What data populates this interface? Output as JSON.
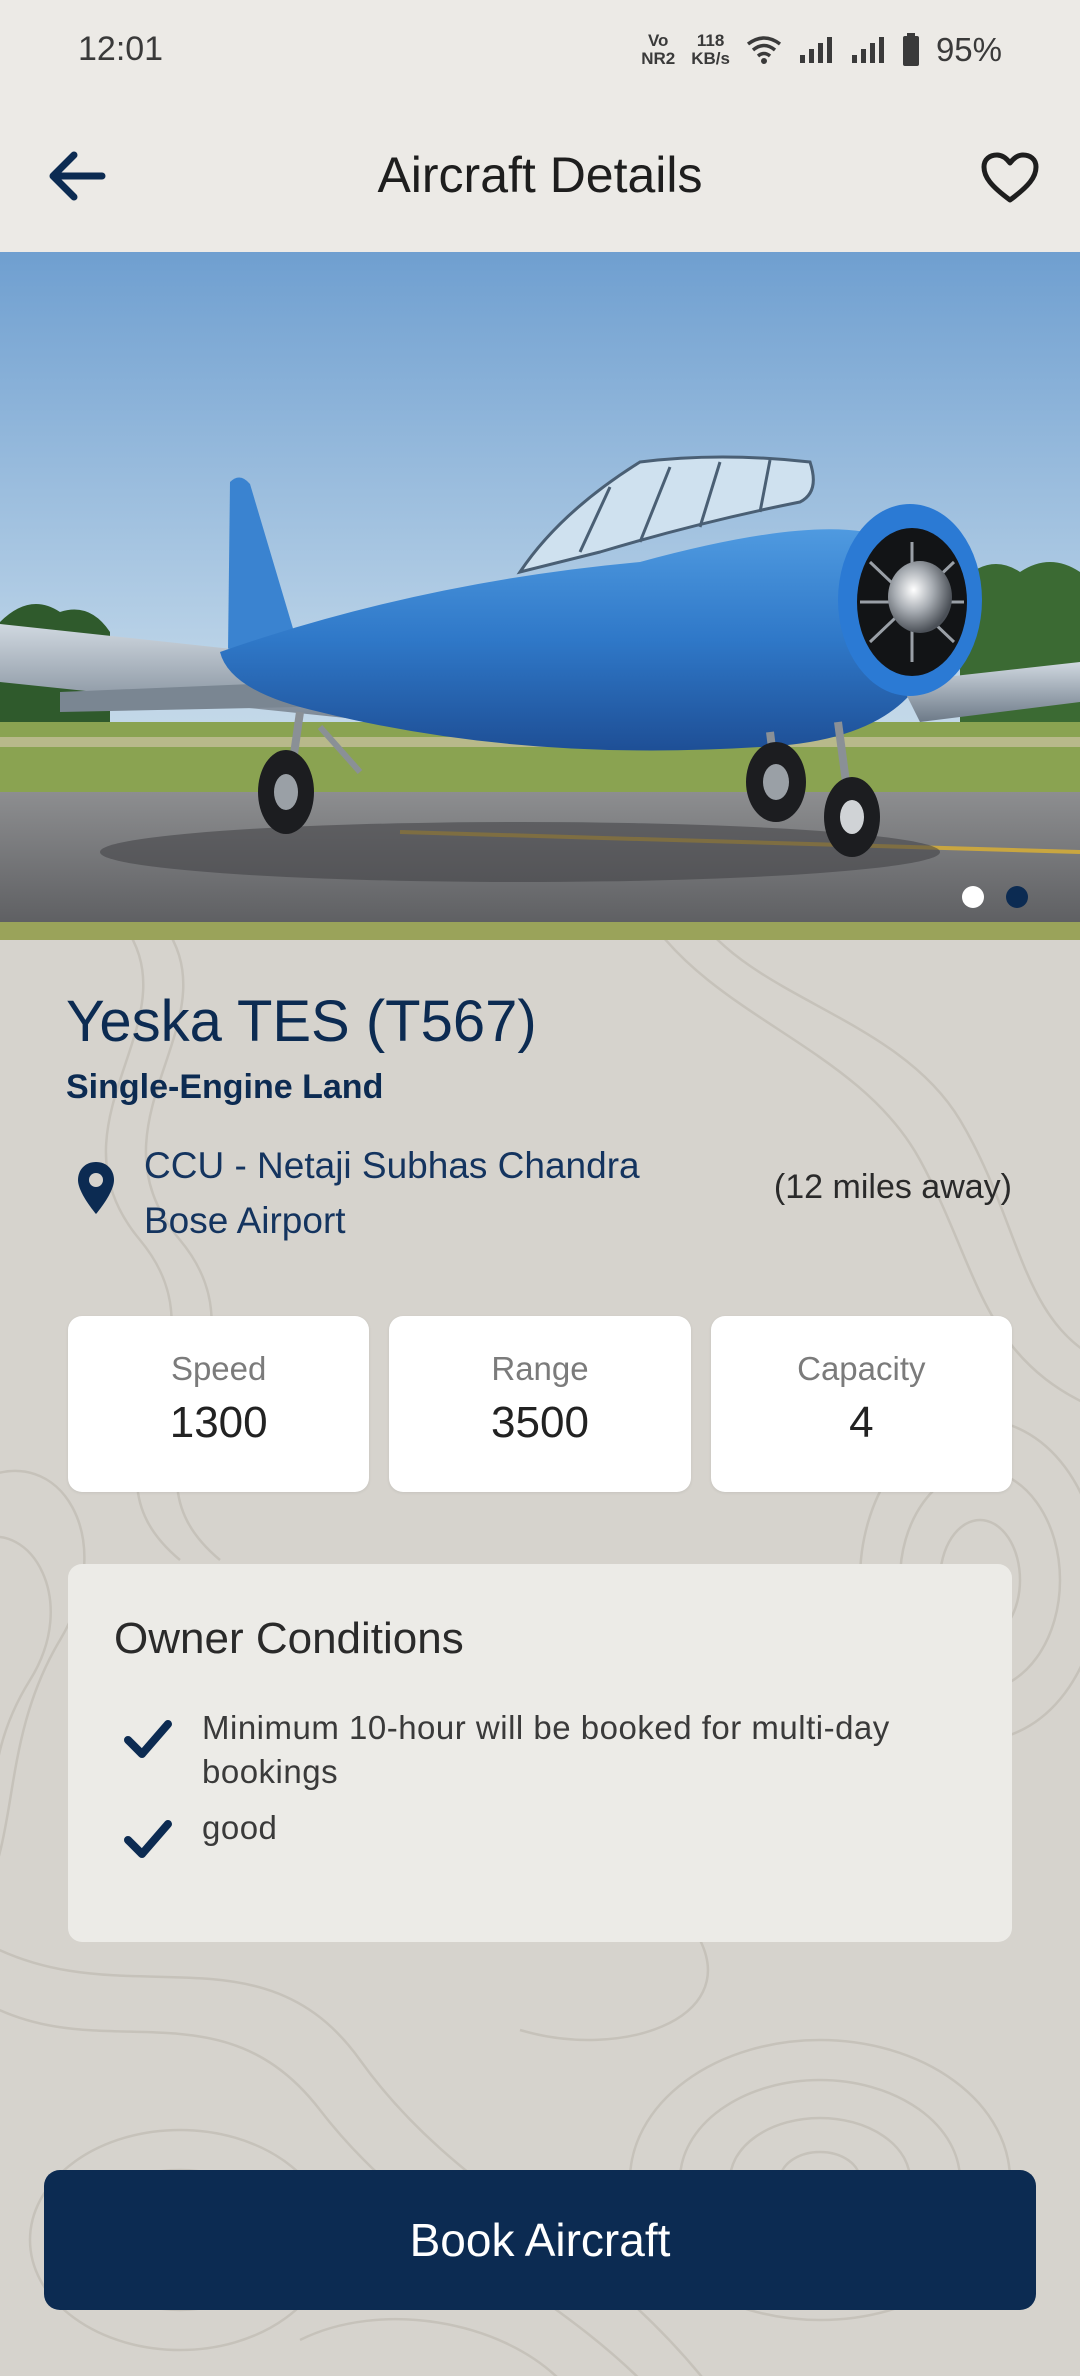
{
  "status_bar": {
    "time": "12:01",
    "network_label_top": "Vo",
    "network_label_bottom": "NR2",
    "speed_value": "118",
    "speed_unit": "KB/s",
    "battery": "95%",
    "icons": [
      "wifi-icon",
      "signal-icon",
      "signal-icon",
      "battery-icon"
    ]
  },
  "app_bar": {
    "title": "Aircraft Details",
    "back_icon": "back-arrow-icon",
    "favorite_icon": "heart-outline-icon"
  },
  "hero": {
    "image": "blue-single-engine-plane-photo",
    "pages": 2,
    "active_page": 2,
    "dot_active_color": "#0c2b52",
    "dot_inactive_color": "#ffffff"
  },
  "aircraft": {
    "name": "Yeska TES (T567)",
    "class": "Single-Engine Land",
    "location": "CCU - Netaji Subhas Chandra Bose Airport",
    "distance": "(12 miles away)"
  },
  "stats": [
    {
      "label": "Speed",
      "value": "1300"
    },
    {
      "label": "Range",
      "value": "3500"
    },
    {
      "label": "Capacity",
      "value": "4"
    }
  ],
  "conditions": {
    "title": "Owner Conditions",
    "items": [
      "Minimum 10-hour will be booked for multi-day bookings",
      "good"
    ]
  },
  "actions": {
    "book_label": "Book Aircraft"
  },
  "colors": {
    "primary": "#0c2b52",
    "background": "#d6d3cd",
    "bar_background": "#eceae6"
  }
}
